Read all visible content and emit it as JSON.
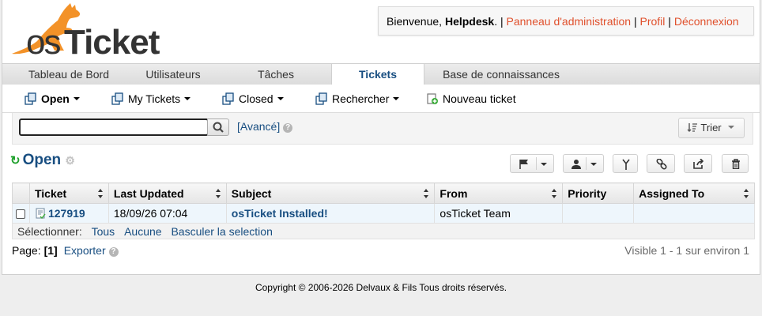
{
  "header": {
    "logo_text": "osTicket",
    "welcome": "Bienvenue, ",
    "user": "Helpdesk",
    "links": [
      "Panneau d'administration",
      "Profil",
      "Déconnexion"
    ]
  },
  "nav": {
    "tabs": [
      {
        "label": "Tableau de Bord"
      },
      {
        "label": "Utilisateurs"
      },
      {
        "label": "Tâches"
      },
      {
        "label": "Tickets",
        "active": true
      },
      {
        "label": "Base de connaissances"
      }
    ]
  },
  "subnav": {
    "items": [
      {
        "label": "Open"
      },
      {
        "label": "My Tickets"
      },
      {
        "label": "Closed"
      },
      {
        "label": "Rechercher"
      },
      {
        "label": "Nouveau ticket"
      }
    ]
  },
  "search": {
    "value": "",
    "placeholder": "",
    "advanced_label": "[Avancé]",
    "sort_label": "Trier"
  },
  "queue": {
    "title": "Open",
    "action_icons": [
      "flag-icon",
      "assign-user-icon",
      "merge-icon",
      "link-icon",
      "share-icon",
      "trash-icon"
    ]
  },
  "table": {
    "columns": [
      "Ticket",
      "Last Updated",
      "Subject",
      "From",
      "Priority",
      "Assigned To"
    ],
    "rows": [
      {
        "ticket": "127919",
        "last_updated": "18/09/26 07:04",
        "subject": "osTicket Installed!",
        "from": "osTicket Team",
        "priority": "",
        "assigned_to": ""
      }
    ],
    "select_label": "Sélectionner:",
    "select_links": [
      "Tous",
      "Aucune",
      "Basculer la selection"
    ]
  },
  "pagination": {
    "label": "Page:",
    "current": "[1]",
    "export_label": "Exporter",
    "visible_text": "Visible 1 - 1 sur environ 1"
  },
  "footer": {
    "copyright": "Copyright © 2006-2026 Delvaux & Fils Tous droits réservés."
  },
  "colors": {
    "brand_blue": "#184e81",
    "accent_orange": "#e0502c",
    "logo_orange": "#f39228",
    "refresh_green": "#1fa02c"
  }
}
